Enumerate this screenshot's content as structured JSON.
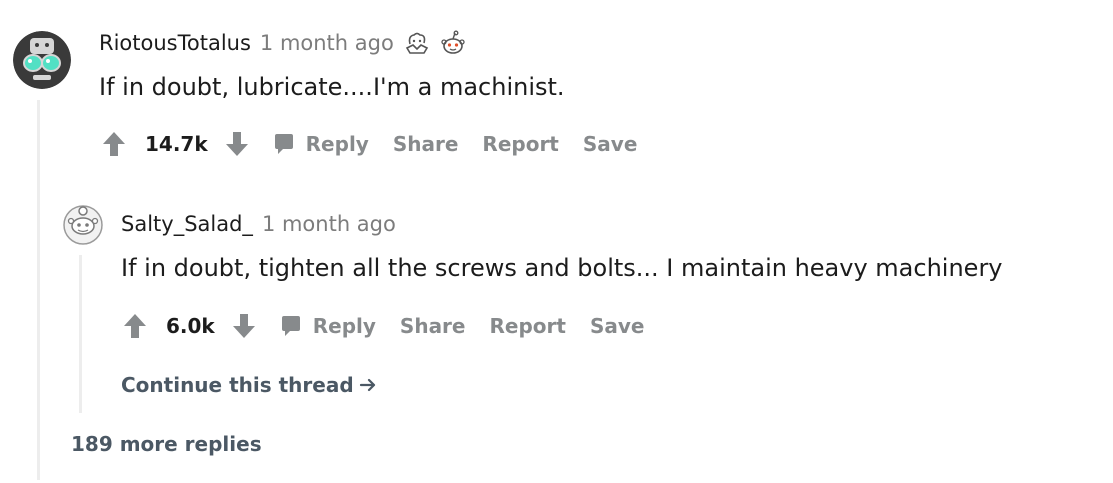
{
  "comments": [
    {
      "username": "RiotousTotalus",
      "timestamp": "1 month ago",
      "awards": [
        "wholesome-award-icon",
        "helpful-award-icon"
      ],
      "body": "If in doubt, lubricate....I'm a machinist.",
      "score": "14.7k",
      "actions": {
        "reply": "Reply",
        "share": "Share",
        "report": "Report",
        "save": "Save"
      }
    },
    {
      "username": "Salty_Salad_",
      "timestamp": "1 month ago",
      "body": "If in doubt, tighten all the screws and bolts... I maintain heavy machinery",
      "score": "6.0k",
      "actions": {
        "reply": "Reply",
        "share": "Share",
        "report": "Report",
        "save": "Save"
      }
    }
  ],
  "continue_thread": "Continue this thread",
  "more_replies": "189 more replies",
  "colors": {
    "text": "#1c1c1c",
    "meta": "#7c7c7c",
    "action": "#878a8c",
    "link": "#4b5864",
    "thread_line": "#ededed",
    "avatar_dark": "#3a3a3a",
    "avatar_goggles": "#52e0c4"
  }
}
